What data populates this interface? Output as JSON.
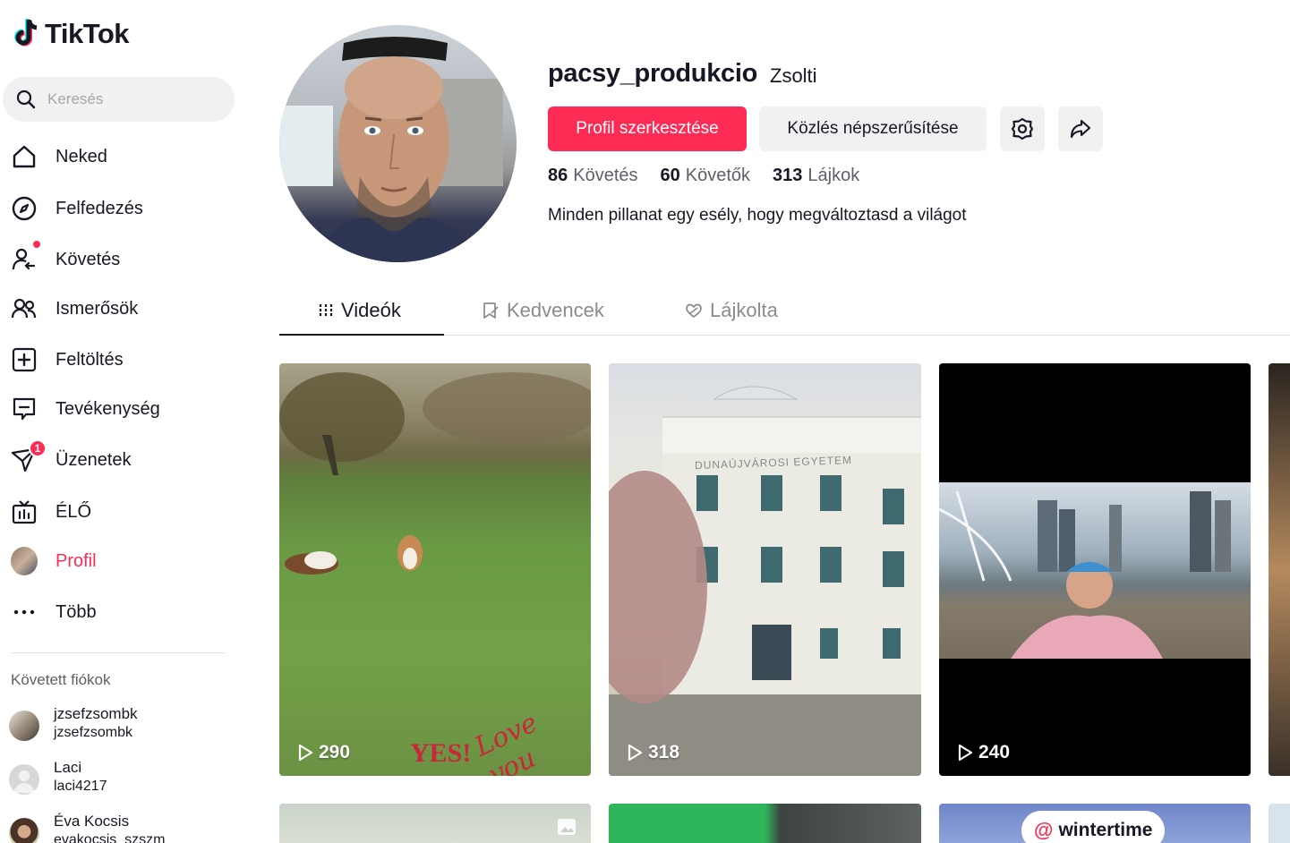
{
  "brand": {
    "name": "TikTok"
  },
  "search": {
    "placeholder": "Keresés"
  },
  "nav": [
    {
      "label": "Neked",
      "icon": "home-icon"
    },
    {
      "label": "Felfedezés",
      "icon": "compass-icon"
    },
    {
      "label": "Követés",
      "icon": "following-icon"
    },
    {
      "label": "Ismerősök",
      "icon": "friends-icon"
    },
    {
      "label": "Feltöltés",
      "icon": "upload-icon"
    },
    {
      "label": "Tevékenység",
      "icon": "activity-icon"
    },
    {
      "label": "Üzenetek",
      "icon": "messages-icon",
      "badge": "1"
    },
    {
      "label": "ÉLŐ",
      "icon": "live-icon"
    },
    {
      "label": "Profil",
      "icon": "avatar",
      "active": true
    },
    {
      "label": "Több",
      "icon": "more-icon"
    }
  ],
  "followed": {
    "title": "Követett fiókok",
    "accounts": [
      {
        "name": "jzsefzsombk",
        "username": "jzsefzsombk"
      },
      {
        "name": "Laci",
        "username": "laci4217"
      },
      {
        "name": "Éva Kocsis",
        "username": "evakocsis_szszm"
      }
    ]
  },
  "profile": {
    "username": "pacsy_produkcio",
    "nickname": "Zsolti",
    "edit_label": "Profil szerkesztése",
    "promote_label": "Közlés népszerűsítése",
    "stats": {
      "following": {
        "count": "86",
        "label": "Követés"
      },
      "followers": {
        "count": "60",
        "label": "Követők"
      },
      "likes": {
        "count": "313",
        "label": "Lájkok"
      }
    },
    "bio": "Minden pillanat egy esély, hogy megváltoztasd a világot"
  },
  "tabs": [
    {
      "label": "Videók",
      "icon": "grid-icon",
      "active": true
    },
    {
      "label": "Kedvencek",
      "icon": "bookmark-icon"
    },
    {
      "label": "Lájkolta",
      "icon": "heart-icon"
    }
  ],
  "videos": [
    {
      "views": "290"
    },
    {
      "views": "318"
    },
    {
      "views": "240"
    }
  ],
  "row2": {
    "mention": "wintertime"
  },
  "overlays": {
    "yes": "YES!",
    "love": "Love you",
    "sign": "DUNAÚJVÁROSI EGYETEM"
  },
  "colors": {
    "accent": "#fe2c55",
    "text": "#161823",
    "muted": "#5f6068",
    "chip": "#f1f1f2"
  }
}
